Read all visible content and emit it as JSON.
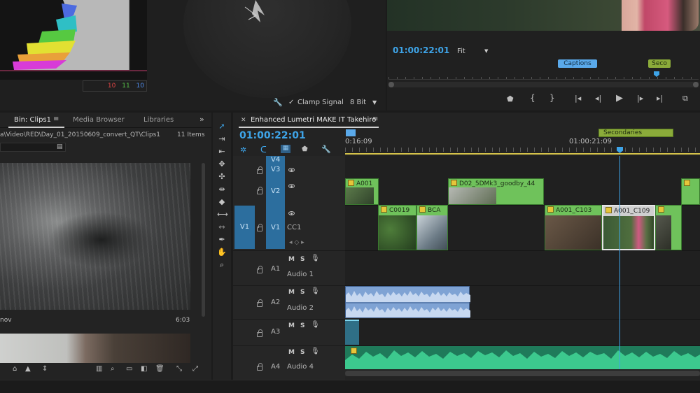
{
  "scopes": {
    "waveform_numbers": [
      "10",
      "11",
      "10"
    ],
    "clamp_signal_label": "Clamp Signal",
    "bit_depth": "8 Bit"
  },
  "program_monitor": {
    "timecode": "01:00:22:01",
    "fit_label": "Fit",
    "markers": [
      "Captions",
      "Seco"
    ]
  },
  "project_panel": {
    "tabs": [
      "Bin: Clips1",
      "Media Browser",
      "Libraries"
    ],
    "path": "a\\Video\\RED\\Day_01_20150609_convert_QT\\Clips1",
    "item_count": "11 Items",
    "clip1_name": "nov",
    "clip1_duration": "6:03"
  },
  "timeline": {
    "title": "Enhanced Lumetri MAKE IT Takehiro",
    "timecode": "01:00:22:01",
    "ruler_times": [
      "0:16:09",
      "01:00:21:09"
    ],
    "marker_label": "Secondaries",
    "tracks": {
      "V4": "V4",
      "V3": "V3",
      "V2": "V2",
      "V1": "V1",
      "V1_source": "V1",
      "CC1": "CC1",
      "A1": "A1",
      "A2": "A2",
      "A3": "A3",
      "A4": "A4",
      "audio1_name": "Audio 1",
      "audio2_name": "Audio 2",
      "audio4_name": "Audio 4"
    },
    "clips": {
      "v2_a": "A001",
      "v2_b": "D02_5DMk3_goodby_44",
      "v1_a": "C0019",
      "v1_b": "BCA",
      "v1_c": "A001_C103",
      "v1_d": "A001_C109"
    },
    "ms_labels": [
      "M",
      "S"
    ]
  },
  "colors": {
    "accent_blue": "#3ea4e8",
    "clip_green": "#6fc25b",
    "audio_blue": "#7fa3d4",
    "audio_green": "#3cc98e",
    "marker_green": "#8bab3a"
  }
}
